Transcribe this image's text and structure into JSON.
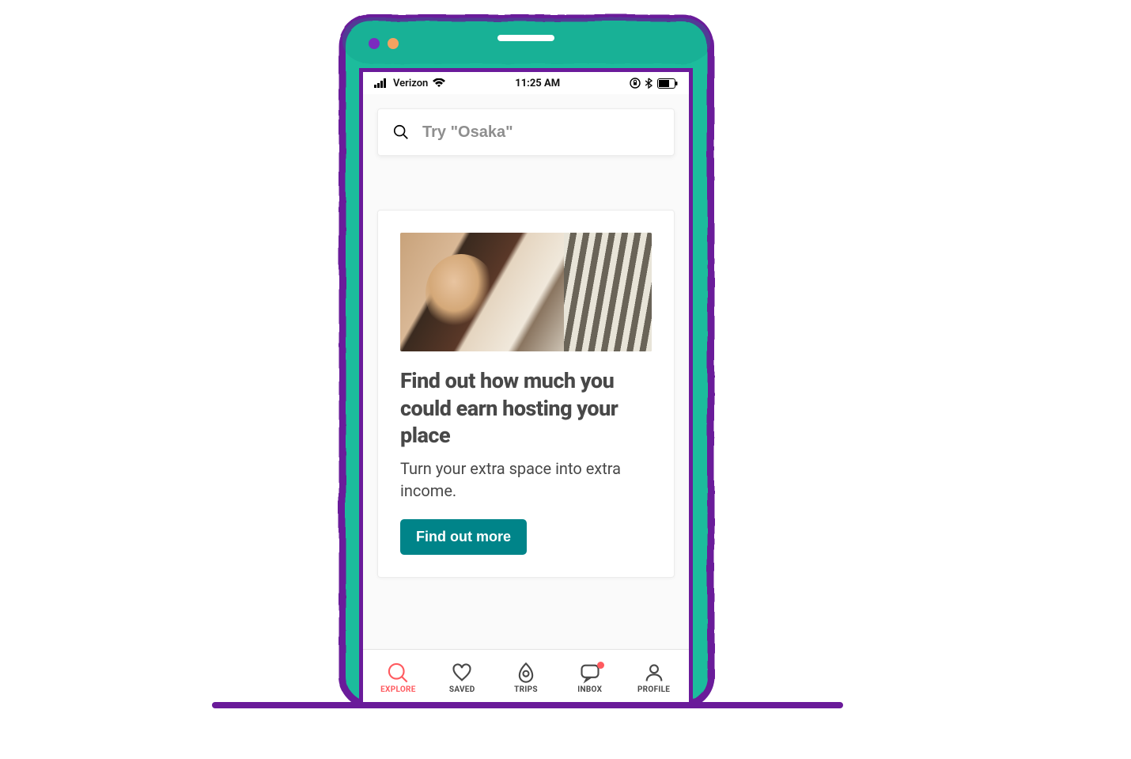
{
  "statusBar": {
    "carrier": "Verizon",
    "time": "11:25 AM"
  },
  "search": {
    "placeholder": "Try \"Osaka\""
  },
  "promo": {
    "title": "Find out how much you could earn hosting your place",
    "subtitle": "Turn your extra space into extra income.",
    "button": "Find out more"
  },
  "nav": {
    "explore": "EXPLORE",
    "saved": "SAVED",
    "trips": "TRIPS",
    "inbox": "INBOX",
    "profile": "PROFILE"
  },
  "colors": {
    "accent": "#ff5a5f",
    "teal": "#008489",
    "frameTeal": "#1abc9c",
    "framePurple": "#6a1b9a"
  }
}
